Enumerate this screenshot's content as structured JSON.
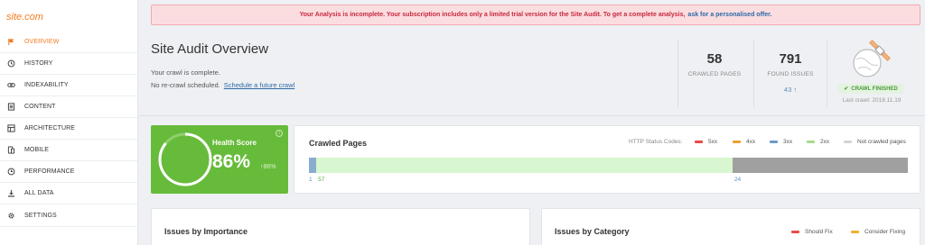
{
  "logo": "site.com",
  "nav": [
    {
      "label": "OVERVIEW",
      "icon": "flag-icon",
      "active": true
    },
    {
      "label": "HISTORY",
      "icon": "history-icon"
    },
    {
      "label": "INDEXABILITY",
      "icon": "link-icon"
    },
    {
      "label": "CONTENT",
      "icon": "document-icon"
    },
    {
      "label": "ARCHITECTURE",
      "icon": "sitemap-icon"
    },
    {
      "label": "MOBILE",
      "icon": "mobile-icon"
    },
    {
      "label": "PERFORMANCE",
      "icon": "clock-icon"
    },
    {
      "label": "ALL DATA",
      "icon": "download-icon"
    },
    {
      "label": "SETTINGS",
      "icon": "gear-icon"
    }
  ],
  "alert": {
    "message": "Your Analysis is incomplete. Your subscription includes only a limited trial version for the Site Audit. To get a complete analysis,",
    "link": "ask for a personalised offer."
  },
  "overview": {
    "title": "Site Audit Overview",
    "crawl_status": "Your crawl is complete.",
    "recrawl_text": "No re-crawl scheduled.",
    "recrawl_link": "Schedule a future crawl"
  },
  "stats": {
    "crawled_pages": "58",
    "crawled_pages_label": "CRAWLED PAGES",
    "found_issues": "791",
    "found_issues_label": "FOUND ISSUES",
    "issues_delta": "43"
  },
  "crawl_finished": "CRAWL FINISHED",
  "last_crawl": "Last crawl: 2018.11.19",
  "health": {
    "label": "Health Score",
    "value": "86%",
    "delta": "86%",
    "ring_fraction": 0.86,
    "info": "i"
  },
  "crawled_pages_card": {
    "title": "Crawled Pages",
    "legend_title": "HTTP Status Codes:",
    "legend": [
      {
        "label": "5xx",
        "color": "#e84a4a"
      },
      {
        "label": "4xx",
        "color": "#f0a030"
      },
      {
        "label": "3xx",
        "color": "#6a9bc8"
      },
      {
        "label": "2xx",
        "color": "#a6dc8e"
      },
      {
        "label": "Not crawled pages",
        "color": "#d4d4d4"
      }
    ],
    "segments": [
      {
        "name": "3xx",
        "value": 1,
        "color": "#8aadcf"
      },
      {
        "name": "2xx",
        "value": 57,
        "color": "#d8f6cf"
      },
      {
        "name": "Not crawled pages",
        "value": 24,
        "color": "#a0a0a0"
      }
    ],
    "bar_labels": [
      "1",
      "57",
      "24"
    ]
  },
  "issues_importance": {
    "title": "Issues by Importance"
  },
  "issues_category": {
    "title": "Issues by Category",
    "legend": [
      {
        "label": "Should Fix",
        "color": "#e84a4a"
      },
      {
        "label": "Consider Fixing",
        "color": "#f0b030"
      }
    ]
  }
}
